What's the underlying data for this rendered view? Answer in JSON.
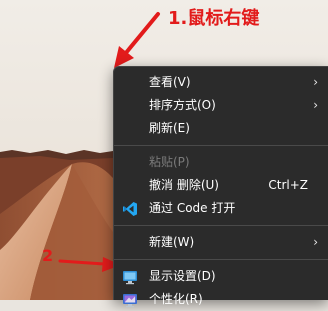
{
  "annotations": {
    "step1": "1.鼠标右键",
    "step2": "2"
  },
  "menu": {
    "items": [
      {
        "label": "查看(V)",
        "submenu": true
      },
      {
        "label": "排序方式(O)",
        "submenu": true
      },
      {
        "label": "刷新(E)"
      },
      {
        "separator": true
      },
      {
        "label": "粘贴(P)",
        "disabled": true
      },
      {
        "label": "撤消 删除(U)",
        "shortcut": "Ctrl+Z"
      },
      {
        "label": "通过 Code 打开",
        "icon": "vscode-icon"
      },
      {
        "separator": true
      },
      {
        "label": "新建(W)",
        "submenu": true
      },
      {
        "separator": true
      },
      {
        "label": "显示设置(D)",
        "icon": "display-settings-icon"
      },
      {
        "label": "个性化(R)",
        "icon": "personalize-icon"
      }
    ],
    "submenu_glyph": "›"
  },
  "colors": {
    "menu_bg": "#2b2b2b",
    "annotation": "#e21b1b"
  }
}
